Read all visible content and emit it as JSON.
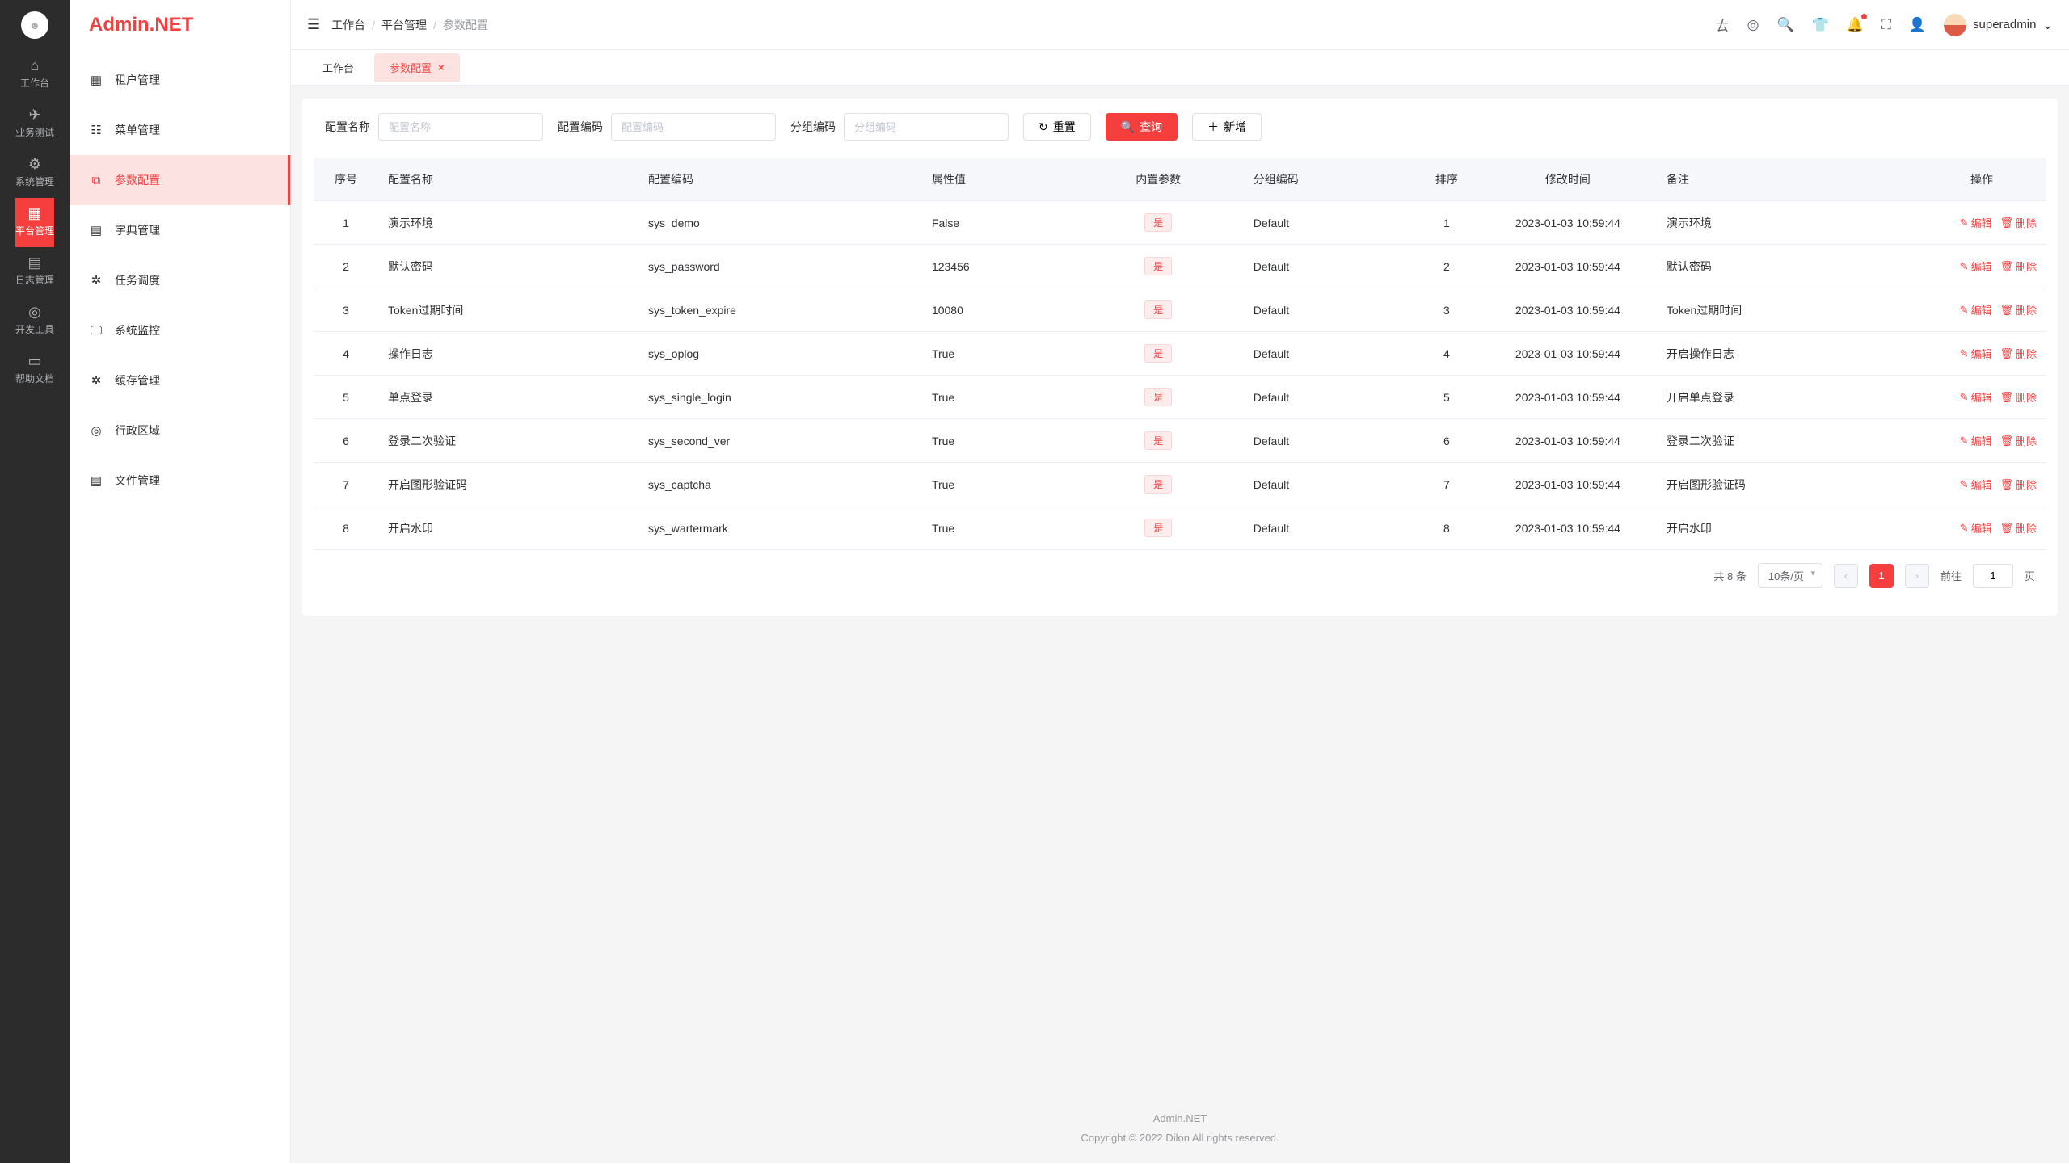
{
  "app": {
    "brand_left": "Admin",
    "brand_dot": ".",
    "brand_right": "NET",
    "watermark_text": "Admin.NET"
  },
  "primaryNav": {
    "items": [
      {
        "icon": "⌂",
        "label": "工作台"
      },
      {
        "icon": "✈",
        "label": "业务测试"
      },
      {
        "icon": "⚙",
        "label": "系统管理"
      },
      {
        "icon": "▦",
        "label": "平台管理"
      },
      {
        "icon": "▤",
        "label": "日志管理"
      },
      {
        "icon": "◎",
        "label": "开发工具"
      },
      {
        "icon": "▭",
        "label": "帮助文档"
      }
    ],
    "activeIndex": 3
  },
  "sideMenu": {
    "items": [
      {
        "icon": "▦",
        "label": "租户管理"
      },
      {
        "icon": "☷",
        "label": "菜单管理"
      },
      {
        "icon": "⧉",
        "label": "参数配置"
      },
      {
        "icon": "▤",
        "label": "字典管理"
      },
      {
        "icon": "✲",
        "label": "任务调度"
      },
      {
        "icon": "🖵",
        "label": "系统监控"
      },
      {
        "icon": "✲",
        "label": "缓存管理"
      },
      {
        "icon": "◎",
        "label": "行政区域"
      },
      {
        "icon": "▤",
        "label": "文件管理"
      }
    ],
    "activeIndex": 2
  },
  "header": {
    "breadcrumb": [
      "工作台",
      "平台管理",
      "参数配置"
    ],
    "username": "superadmin"
  },
  "tabs": {
    "items": [
      {
        "label": "工作台",
        "closable": false
      },
      {
        "label": "参数配置",
        "closable": true
      }
    ],
    "activeIndex": 1
  },
  "search": {
    "name_label": "配置名称",
    "name_placeholder": "配置名称",
    "code_label": "配置编码",
    "code_placeholder": "配置编码",
    "group_label": "分组编码",
    "group_placeholder": "分组编码",
    "reset_label": "重置",
    "query_label": "查询",
    "add_label": "新增"
  },
  "table": {
    "columns": [
      "序号",
      "配置名称",
      "配置编码",
      "属性值",
      "内置参数",
      "分组编码",
      "排序",
      "修改时间",
      "备注",
      "操作"
    ],
    "builtin_yes": "是",
    "op_edit": "编辑",
    "op_delete": "删除",
    "rows": [
      {
        "idx": "1",
        "name": "演示环境",
        "code": "sys_demo",
        "value": "False",
        "builtin": true,
        "group": "Default",
        "order": "1",
        "time": "2023-01-03 10:59:44",
        "remark": "演示环境"
      },
      {
        "idx": "2",
        "name": "默认密码",
        "code": "sys_password",
        "value": "123456",
        "builtin": true,
        "group": "Default",
        "order": "2",
        "time": "2023-01-03 10:59:44",
        "remark": "默认密码"
      },
      {
        "idx": "3",
        "name": "Token过期时间",
        "code": "sys_token_expire",
        "value": "10080",
        "builtin": true,
        "group": "Default",
        "order": "3",
        "time": "2023-01-03 10:59:44",
        "remark": "Token过期时间"
      },
      {
        "idx": "4",
        "name": "操作日志",
        "code": "sys_oplog",
        "value": "True",
        "builtin": true,
        "group": "Default",
        "order": "4",
        "time": "2023-01-03 10:59:44",
        "remark": "开启操作日志"
      },
      {
        "idx": "5",
        "name": "单点登录",
        "code": "sys_single_login",
        "value": "True",
        "builtin": true,
        "group": "Default",
        "order": "5",
        "time": "2023-01-03 10:59:44",
        "remark": "开启单点登录"
      },
      {
        "idx": "6",
        "name": "登录二次验证",
        "code": "sys_second_ver",
        "value": "True",
        "builtin": true,
        "group": "Default",
        "order": "6",
        "time": "2023-01-03 10:59:44",
        "remark": "登录二次验证"
      },
      {
        "idx": "7",
        "name": "开启图形验证码",
        "code": "sys_captcha",
        "value": "True",
        "builtin": true,
        "group": "Default",
        "order": "7",
        "time": "2023-01-03 10:59:44",
        "remark": "开启图形验证码"
      },
      {
        "idx": "8",
        "name": "开启水印",
        "code": "sys_wartermark",
        "value": "True",
        "builtin": true,
        "group": "Default",
        "order": "8",
        "time": "2023-01-03 10:59:44",
        "remark": "开启水印"
      }
    ]
  },
  "pagination": {
    "total_text": "共 8 条",
    "page_size": "10条/页",
    "current": "1",
    "goto_label": "前往",
    "goto_value": "1",
    "page_suffix": "页"
  },
  "footer": {
    "line1": "Admin.NET",
    "line2": "Copyright © 2022 Dilon All rights reserved."
  }
}
